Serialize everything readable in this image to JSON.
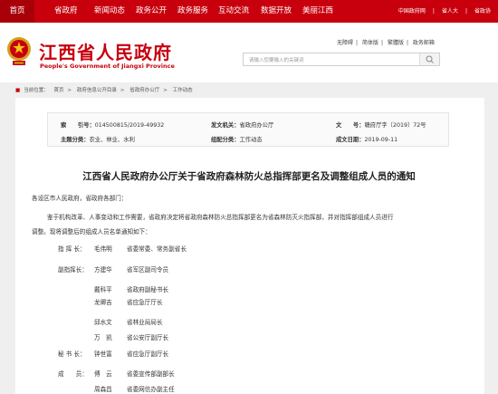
{
  "topnav": {
    "items": [
      "首页",
      "省政府",
      "新闻动态",
      "政务公开",
      "政务服务",
      "互动交流",
      "数据开放",
      "美丽江西"
    ],
    "right_links": [
      "中国政府网",
      "省人大",
      "省政协"
    ]
  },
  "header": {
    "title": "江西省人民政府",
    "subtitle": "People's Government of Jiangxi Province",
    "util_links": [
      "无障碍",
      "简体版",
      "繁體版",
      "政务邮箱"
    ],
    "search_placeholder": "请输入您要输入的关键词"
  },
  "breadcrumb": {
    "label": "当前位置：",
    "items": [
      "首页",
      "政府信息公开目录",
      "省政府办公厅",
      "工作动态"
    ],
    "separator": ">"
  },
  "meta": {
    "index_label": "索　　引号：",
    "index_value": "014500815/2019-49932",
    "issuer_label": "发文机关：",
    "issuer_value": "省政府办公厅",
    "docno_label": "文　　号：",
    "docno_value": "赣府厅字〔2019〕72号",
    "subject_label": "主题分类：",
    "subject_value": "农业、林业、水利",
    "category_label": "组配分类：",
    "category_value": "工作动态",
    "date_label": "成文日期：",
    "date_value": "2019-09-11"
  },
  "document": {
    "title": "江西省人民政府办公厅关于省政府森林防火总指挥部更名及调整组成人员的通知",
    "salutation": "各设区市人民政府，省政府各部门：",
    "para1_line1": "鉴于机构改革、人事变动和工作需要，省政府决定将省政府森林防火总指挥部更名为省森林防灭火指挥部，并对指挥部组成人员进行",
    "para1_line2": "调整。现将调整后的组成人员名单通知如下：",
    "members": [
      {
        "role": "指 挥 长：",
        "name": "毛伟明",
        "title": "省委常委、常务副省长"
      },
      {
        "role": "副指挥长：",
        "name": "方建华",
        "title": "省军区副司令员"
      },
      {
        "role": "",
        "name": "戴科平",
        "title": "省政府副秘书长"
      },
      {
        "role": "",
        "name": "龙卿吉",
        "title": "省应急厅厅长"
      },
      {
        "role": "",
        "name": "邱水文",
        "title": "省林业局局长"
      },
      {
        "role": "",
        "name": "万　凯",
        "title": "省公安厅副厅长"
      },
      {
        "role": "秘 书 长：",
        "name": "钟世富",
        "title": "省应急厅副厅长"
      },
      {
        "role": "成　　员：",
        "name": "傅　云",
        "title": "省委宣传部副部长"
      },
      {
        "role": "",
        "name": "周森昌",
        "title": "省委网信办副主任"
      }
    ]
  }
}
